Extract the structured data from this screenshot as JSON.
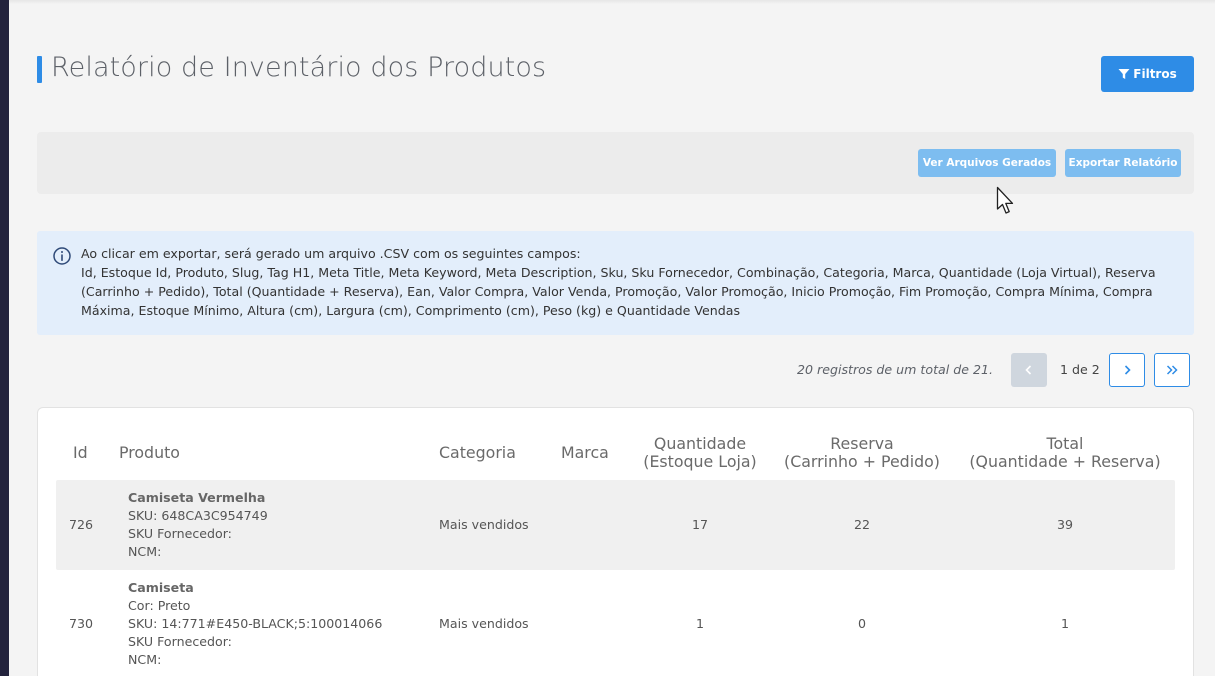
{
  "page": {
    "title": "Relatório de Inventário dos Produtos",
    "filters_label": "Filtros"
  },
  "export": {
    "view_files_label": "Ver Arquivos Gerados",
    "export_label": "Exportar Relatório"
  },
  "info": {
    "line1": "Ao clicar em exportar, será gerado um arquivo .CSV com os seguintes campos:",
    "fields": "Id, Estoque Id, Produto, Slug, Tag H1, Meta Title, Meta Keyword, Meta Description, Sku, Sku Fornecedor, Combinação, Categoria, Marca, Quantidade (Loja Virtual), Reserva (Carrinho + Pedido), Total (Quantidade + Reserva), Ean, Valor Compra, Valor Venda, Promoção, Valor Promoção, Inicio Promoção, Fim Promoção, Compra Mínima, Compra Máxima, Estoque Mínimo, Altura (cm), Largura (cm), Comprimento (cm), Peso (kg) e Quantidade Vendas"
  },
  "pagination": {
    "summary": "20 registros de um total de 21.",
    "page_info": "1 de 2"
  },
  "table": {
    "headers": {
      "id": "Id",
      "produto": "Produto",
      "categoria": "Categoria",
      "marca": "Marca",
      "quantidade_l1": "Quantidade",
      "quantidade_l2": "(Estoque Loja)",
      "reserva_l1": "Reserva",
      "reserva_l2": "(Carrinho + Pedido)",
      "total_l1": "Total",
      "total_l2": "(Quantidade + Reserva)"
    },
    "rows": [
      {
        "id": "726",
        "name": "Camiseta Vermelha",
        "sku": "SKU: 648CA3C954749",
        "sku_fornecedor": "SKU Fornecedor:",
        "ncm": "NCM:",
        "categoria": "Mais vendidos",
        "marca": "",
        "quantidade": "17",
        "reserva": "22",
        "total": "39"
      },
      {
        "id": "730",
        "name": "Camiseta",
        "cor": "Cor: Preto",
        "sku": "SKU: 14:771#E450-BLACK;5:100014066",
        "sku_fornecedor": "SKU Fornecedor:",
        "ncm": "NCM:",
        "categoria": "Mais vendidos",
        "marca": "",
        "quantidade": "1",
        "reserva": "0",
        "total": "1"
      }
    ]
  },
  "colors": {
    "primary": "#2e8ce6",
    "primary_light": "#7dbdf0",
    "info_bg": "#e3eefb",
    "sidebar": "#23233d"
  }
}
